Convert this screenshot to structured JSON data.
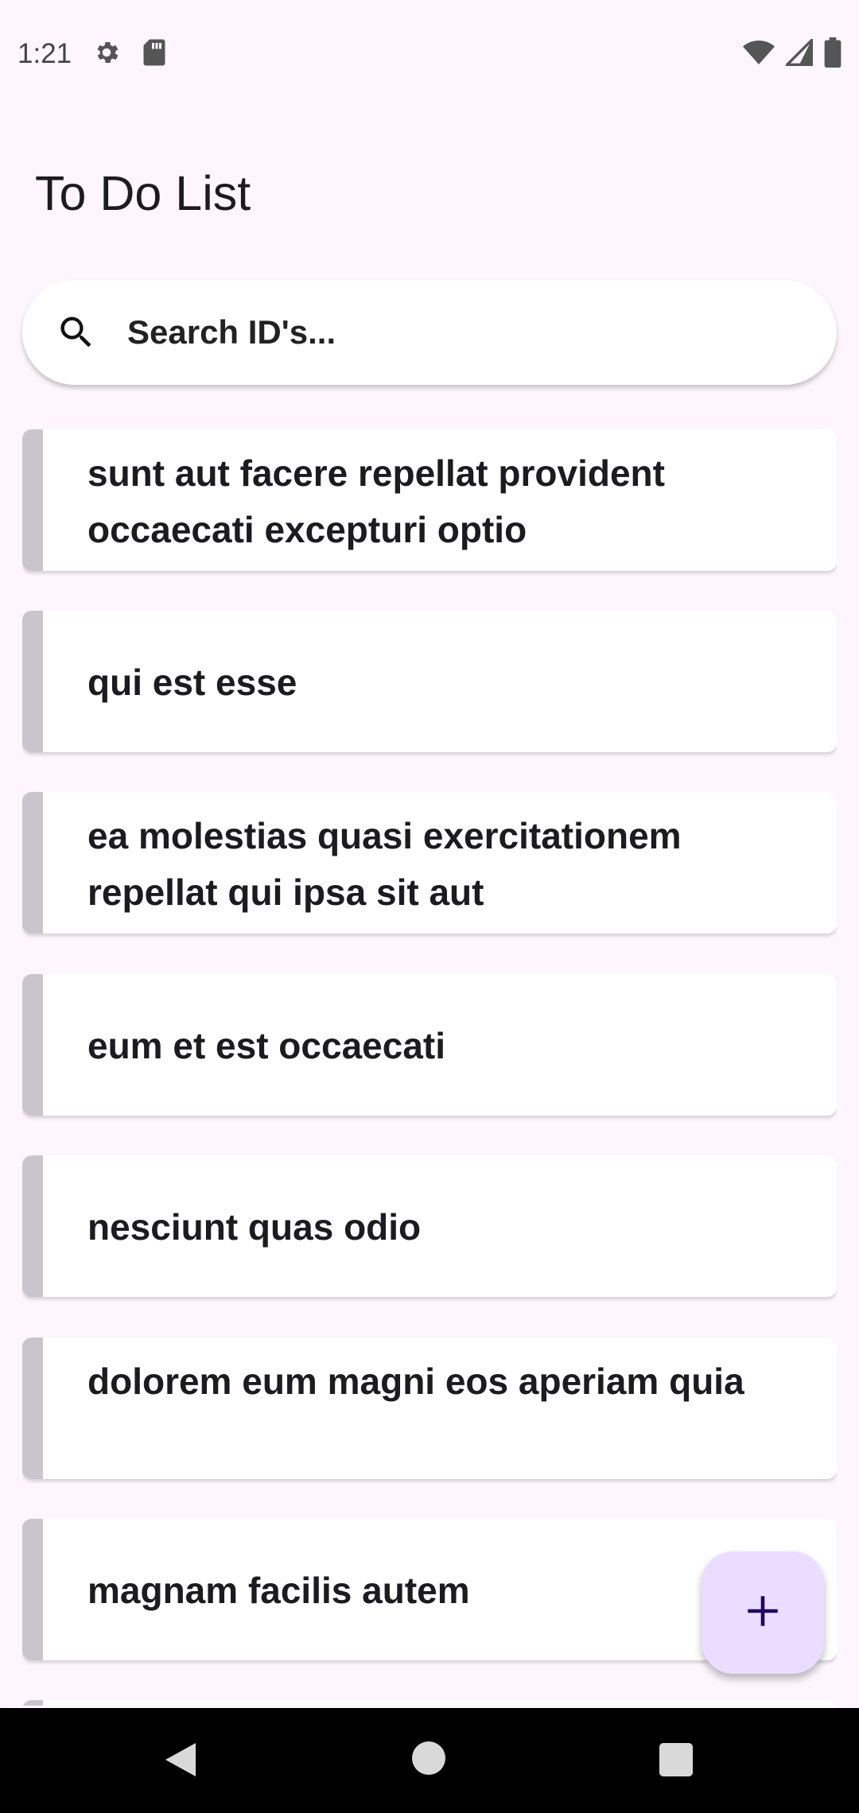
{
  "status_bar": {
    "time": "1:21",
    "icons": [
      "gear-icon",
      "sd-card-icon",
      "wifi-icon",
      "signal-icon",
      "battery-icon"
    ]
  },
  "header": {
    "title": "To Do List"
  },
  "search": {
    "placeholder": "Search ID's...",
    "icon": "search-icon"
  },
  "list": {
    "items": [
      {
        "title": "sunt aut facere repellat provident occaecati excepturi optio"
      },
      {
        "title": "qui est esse"
      },
      {
        "title": "ea molestias quasi exercitationem repellat qui ipsa sit aut"
      },
      {
        "title": "eum et est occaecati"
      },
      {
        "title": "nesciunt quas odio"
      },
      {
        "title": "dolorem eum magni eos aperiam quia"
      },
      {
        "title": "magnam facilis autem"
      }
    ]
  },
  "fab": {
    "icon": "plus-icon"
  },
  "colors": {
    "background": "#fdf7fd",
    "card": "#ffffff",
    "accent_strip": "#c9c5cd",
    "fab": "#eaddff",
    "fab_icon": "#21005d"
  }
}
